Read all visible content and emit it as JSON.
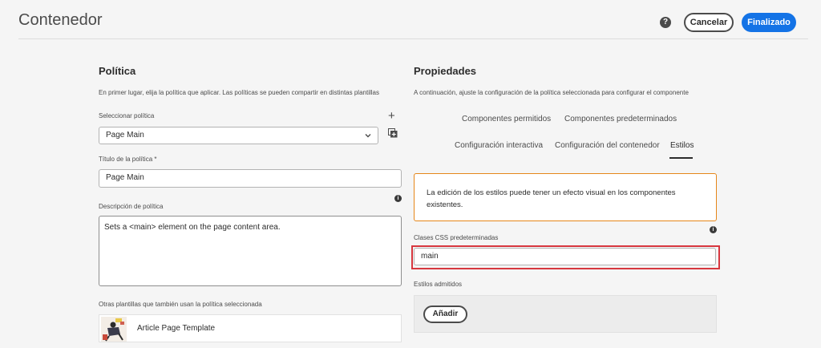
{
  "header": {
    "title": "Contenedor",
    "help_icon": "?",
    "cancel_label": "Cancelar",
    "done_label": "Finalizado"
  },
  "policy": {
    "title": "Política",
    "intro": "En primer lugar, elija la política que aplicar. Las políticas se pueden compartir en distintas plantillas",
    "select_label": "Seleccionar política",
    "select_value": "Page Main",
    "title_label": "Título de la política *",
    "title_value": "Page Main",
    "description_label": "Descripción de política",
    "description_value": "Sets a <main> element on the page content area.",
    "other_templates_label": "Otras plantillas que también usan la política seleccionada",
    "templates": [
      {
        "name": "Article Page Template"
      }
    ]
  },
  "properties": {
    "title": "Propiedades",
    "intro": "A continuación, ajuste la configuración de la política seleccionada para configurar el componente",
    "tabs": [
      {
        "label": "Componentes permitidos"
      },
      {
        "label": "Componentes predeterminados"
      },
      {
        "label": "Configuración interactiva"
      },
      {
        "label": "Configuración del contenedor"
      },
      {
        "label": "Estilos"
      }
    ],
    "active_tab": "Estilos",
    "warning": "La edición de los estilos puede tener un efecto visual en los componentes existentes.",
    "css_classes_label": "Clases CSS predeterminadas",
    "css_classes_value": "main",
    "allowed_styles_label": "Estilos admitidos",
    "add_label": "Añadir"
  },
  "colors": {
    "accent": "#1473e6",
    "warning_border": "#e68619",
    "highlight": "#d7373f"
  }
}
